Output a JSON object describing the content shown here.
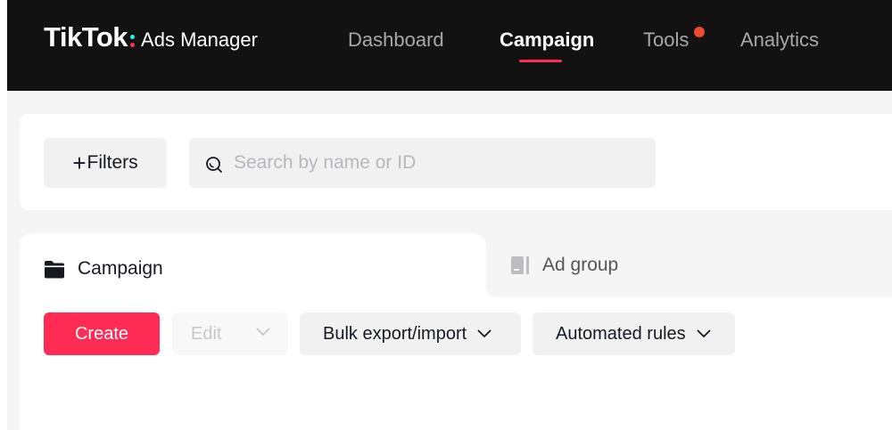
{
  "header": {
    "logo_brand": "TikTok",
    "logo_product": "Ads Manager",
    "nav": [
      {
        "label": "Dashboard",
        "active": false
      },
      {
        "label": "Campaign",
        "active": true
      },
      {
        "label": "Tools",
        "active": false,
        "notification": true
      },
      {
        "label": "Analytics",
        "active": false
      }
    ]
  },
  "filters": {
    "filters_label": "Filters",
    "search_placeholder": "Search by name or ID",
    "search_value": ""
  },
  "tabs": [
    {
      "label": "Campaign",
      "icon": "folder-icon",
      "active": true
    },
    {
      "label": "Ad group",
      "icon": "ad-group-icon",
      "active": false
    }
  ],
  "toolbar": {
    "create_label": "Create",
    "edit_label": "Edit",
    "bulk_label": "Bulk export/import",
    "automated_label": "Automated rules"
  },
  "colors": {
    "accent": "#fe2c55",
    "header_bg": "#121212",
    "logo_cyan": "#25f4ee",
    "notification": "#ee4b2b"
  }
}
